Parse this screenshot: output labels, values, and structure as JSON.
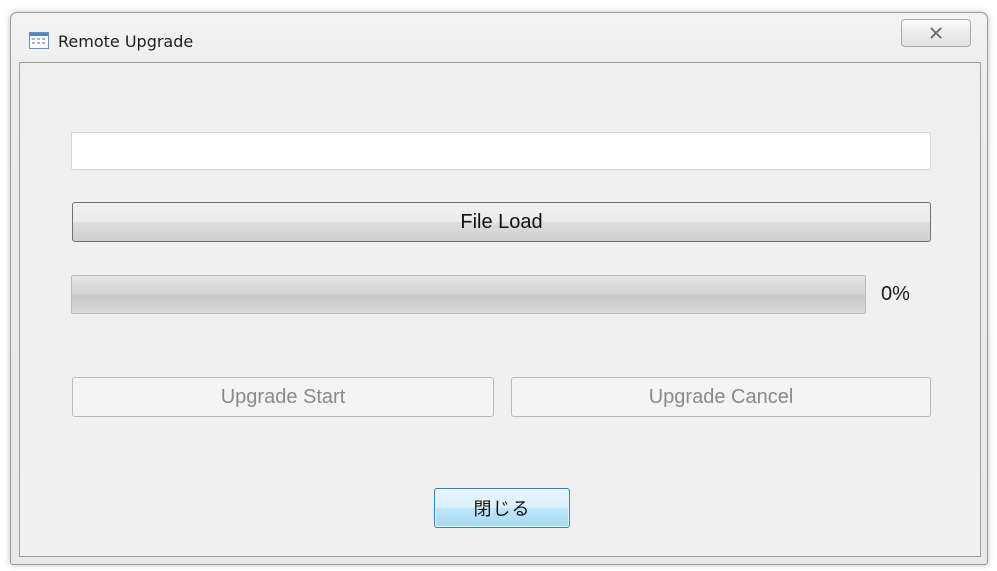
{
  "window": {
    "title": "Remote Upgrade",
    "icon": "window-app-icon",
    "close_icon": "close-x-icon"
  },
  "file_path": {
    "value": "",
    "placeholder": ""
  },
  "buttons": {
    "file_load": "File Load",
    "upgrade_start": "Upgrade Start",
    "upgrade_cancel": "Upgrade Cancel",
    "close": "閉じる"
  },
  "progress": {
    "value_percent": 0,
    "label": "0%"
  },
  "colors": {
    "default_button_border": "#3c7fb1",
    "default_button_fill": "#bee6fd",
    "disabled_text": "#8a8a8a"
  }
}
